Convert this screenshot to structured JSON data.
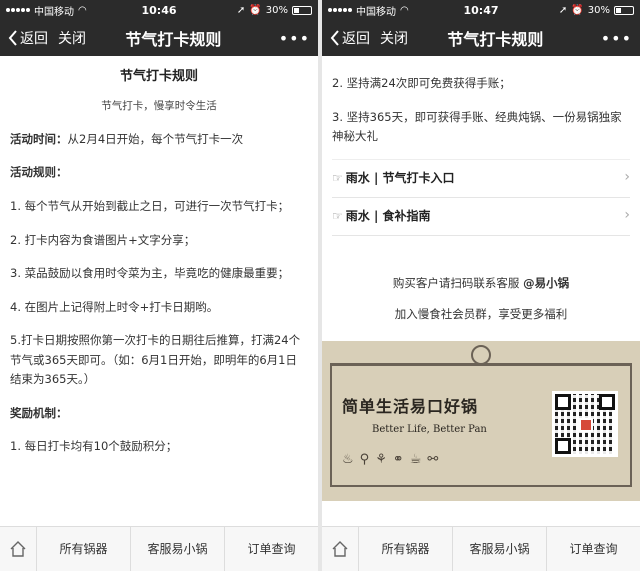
{
  "status": {
    "carrier": "中国移动",
    "time_left": "10:46",
    "time_right": "10:47",
    "battery": "30%"
  },
  "nav": {
    "back": "返回",
    "close": "关闭",
    "title": "节气打卡规则",
    "more": "•••"
  },
  "left": {
    "title": "节气打卡规则",
    "subtitle": "节气打卡，慢享时令生活",
    "time_label": "活动时间：",
    "time_text": "从2月4日开始，每个节气打卡一次",
    "rules_label": "活动规则：",
    "rules": [
      "1. 每个节气从开始到截止之日，可进行一次节气打卡；",
      "2. 打卡内容为食谱图片+文字分享；",
      "3. 菜品鼓励以食用时令菜为主，毕竟吃的健康最重要；",
      "4. 在图片上记得附上时令+打卡日期哟。",
      "5.打卡日期按照你第一次打卡的日期往后推算，打满24个节气或365天即可。（如：6月1日开始，即明年的6月1日结束为365天。）"
    ],
    "reward_label": "奖励机制：",
    "reward_1": "1. 每日打卡均有10个鼓励积分；"
  },
  "right": {
    "reward_2": "2. 坚持满24次即可免费获得手账；",
    "reward_3": "3. 坚持365天，即可获得手账、经典炖锅、一份易锅独家神秘大礼",
    "link_1": "雨水 | 节气打卡入口",
    "link_2": "雨水 | 食补指南",
    "contact_prefix": "购买客户请扫码联系客服 ",
    "contact_name": "@易小锅",
    "join_text": "加入慢食社会员群，享受更多福利",
    "banner_title": "简单生活易口好锅",
    "banner_en": "Better Life,  Better Pan"
  },
  "tabs": [
    "所有锅器",
    "客服易小锅",
    "订单查询"
  ],
  "icons": {
    "back": "chevron-left-icon",
    "home": "home-icon",
    "hand": "pointing-hand-icon",
    "arrow": "chevron-right-icon"
  }
}
